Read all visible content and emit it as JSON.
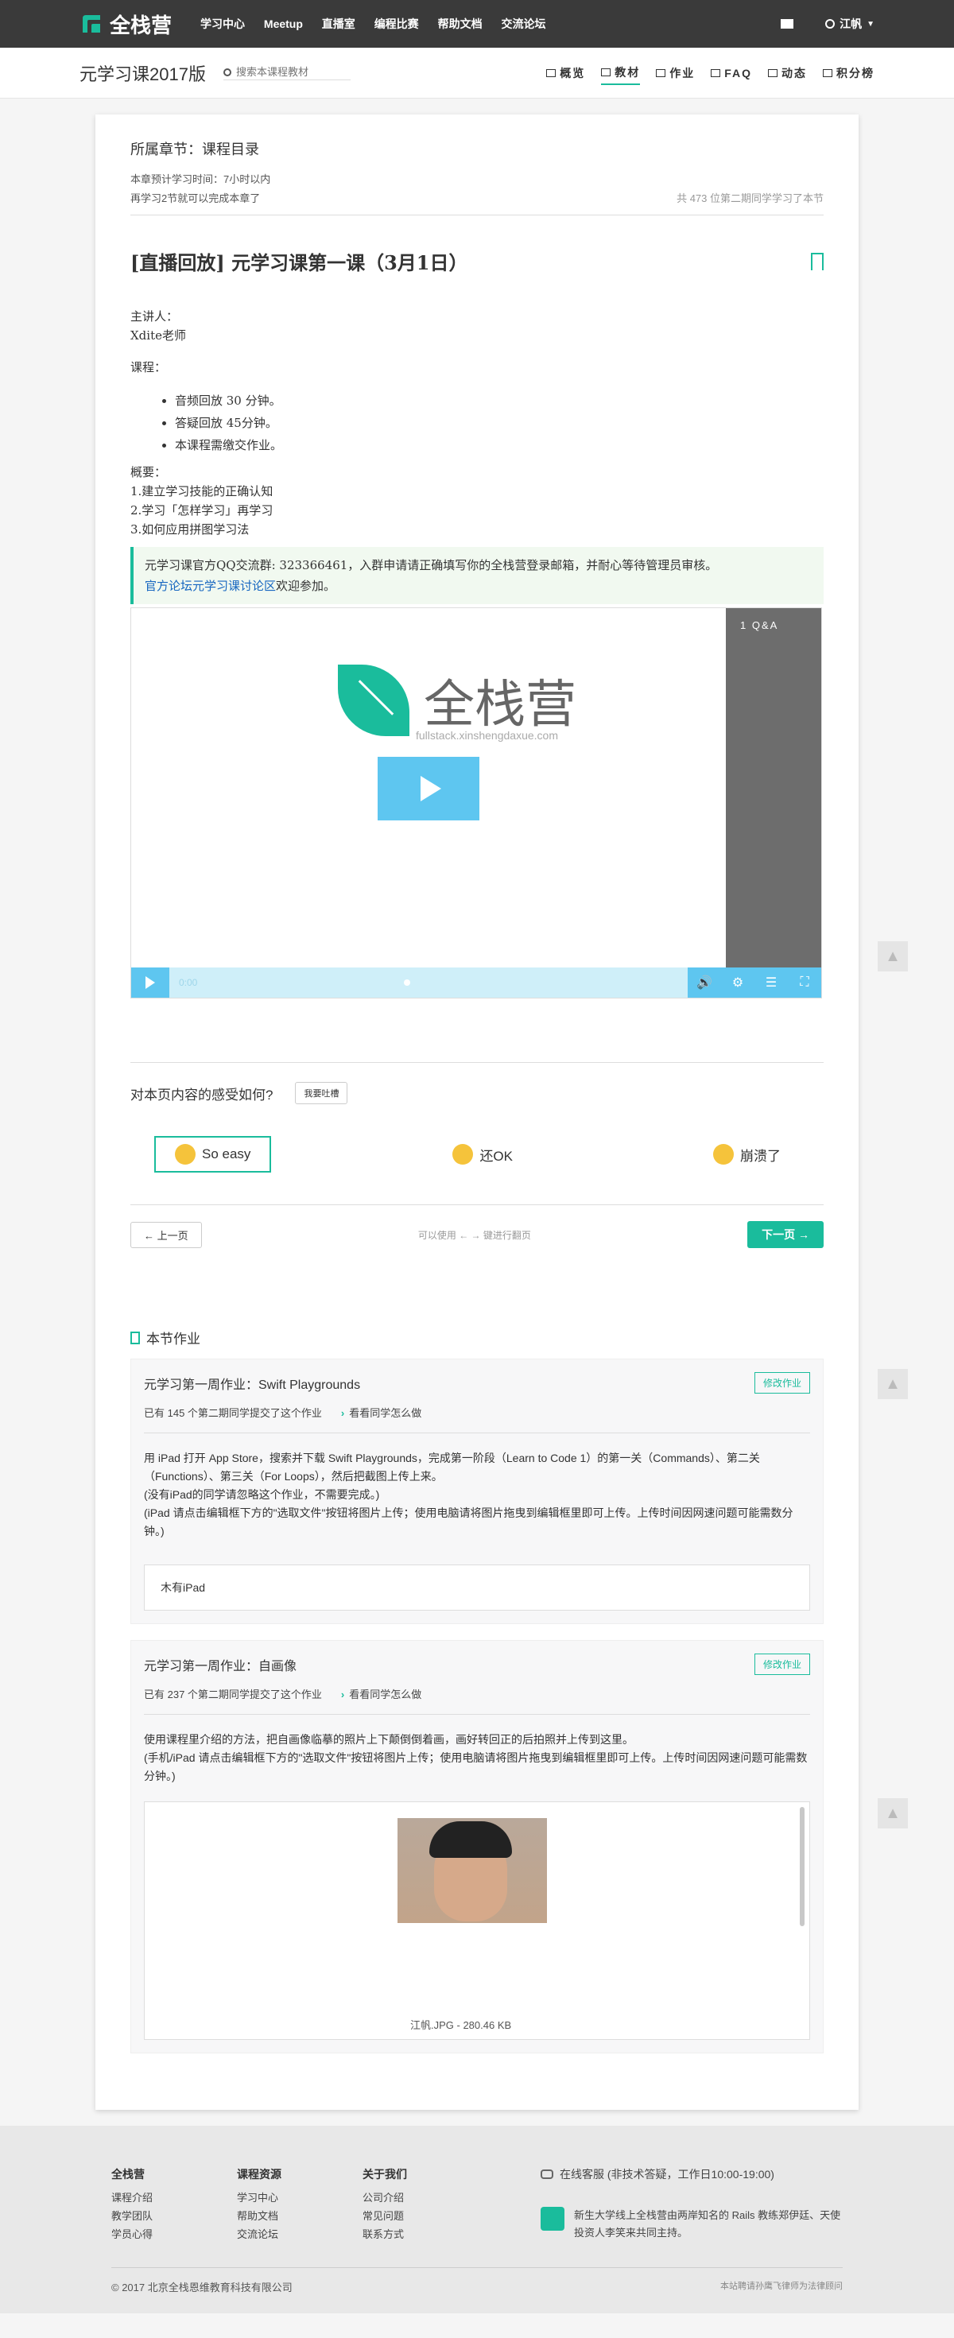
{
  "header": {
    "brand": "全栈营",
    "nav": [
      "学习中心",
      "Meetup",
      "直播室",
      "编程比赛",
      "帮助文档",
      "交流论坛"
    ],
    "user": "江帆"
  },
  "subnav": {
    "course_title": "元学习课2017版",
    "search_placeholder": "搜索本课程教材",
    "tabs": [
      "概览",
      "教材",
      "作业",
      "FAQ",
      "动态",
      "积分榜"
    ],
    "active_tab": "教材"
  },
  "chapter": {
    "label": "所属章节：课程目录",
    "time": "本章预计学习时间：7小时以内",
    "progress": "再学习2节就可以完成本章了",
    "learners": "共 473 位第二期同学学习了本节"
  },
  "lesson": {
    "title": "[直播回放] 元学习课第一课（3月1日）",
    "lecturer_label": "主讲人：",
    "lecturer": "Xdite老师",
    "course_label": "课程：",
    "items": [
      "音频回放 30 分钟。",
      "答疑回放 45分钟。",
      "本课程需缴交作业。"
    ],
    "summary_label": "概要：",
    "summary": [
      "1.建立学习技能的正确认知",
      "2.学习「怎样学习」再学习",
      "3.如何应用拼图学习法"
    ],
    "notice_text": "元学习课官方QQ交流群: 323366461，入群申请请正确填写你的全栈营登录邮箱，并耐心等待管理员审核。",
    "notice_link": "官方论坛元学习课讨论区",
    "notice_tail": "欢迎参加。"
  },
  "player": {
    "qa_label": "1 Q&A",
    "logo_text": "全栈营",
    "logo_sub": "fullstack.xinshengdaxue.com",
    "time": "0:00"
  },
  "feedback": {
    "question": "对本页内容的感受如何?",
    "complain_button": "我要吐槽",
    "choices": [
      "So easy",
      "还OK",
      "崩溃了"
    ]
  },
  "pager": {
    "prev": "上一页",
    "hint": "可以使用 ← → 键进行翻页",
    "next": "下一页"
  },
  "homework": {
    "section_title": "本节作业",
    "cards": [
      {
        "name": "元学习第一周作业：Swift Playgrounds",
        "edit": "修改作业",
        "submitted": "已有 145 个第二期同学提交了这个作业",
        "see": "看看同学怎么做",
        "desc": "用 iPad 打开 App Store，搜索并下载 Swift Playgrounds，完成第一阶段（Learn to Code 1）的第一关（Commands）、第二关（Functions）、第三关（For Loops），然后把截图上传上来。\n(没有iPad的同学请忽略这个作业，不需要完成。)\n(iPad 请点击编辑框下方的\"选取文件\"按钮将图片上传；使用电脑请将图片拖曳到编辑框里即可上传。上传时间因网速问题可能需数分钟。)",
        "answer": "木有iPad"
      },
      {
        "name": "元学习第一周作业：自画像",
        "edit": "修改作业",
        "submitted": "已有 237 个第二期同学提交了这个作业",
        "see": "看看同学怎么做",
        "desc": "使用课程里介绍的方法，把自画像临摹的照片上下颠倒倒着画，画好转回正的后拍照并上传到这里。\n(手机/iPad 请点击编辑框下方的\"选取文件\"按钮将图片上传；使用电脑请将图片拖曳到编辑框里即可上传。上传时间因网速问题可能需数分钟。)",
        "image_caption": "江帆.JPG - 280.46 KB"
      }
    ]
  },
  "footer": {
    "cols": [
      {
        "title": "全栈营",
        "links": [
          "课程介绍",
          "教学团队",
          "学员心得"
        ]
      },
      {
        "title": "课程资源",
        "links": [
          "学习中心",
          "帮助文档",
          "交流论坛"
        ]
      },
      {
        "title": "关于我们",
        "links": [
          "公司介绍",
          "常见问题",
          "联系方式"
        ]
      }
    ],
    "service": "在线客服 (非技术答疑，工作日10:00-19:00)",
    "intro": "新生大学线上全栈营由两岸知名的 Rails 教练郑伊廷、天使投资人李笑来共同主持。",
    "copyright": "© 2017 北京全栈恩维教育科技有限公司",
    "legal": "本站聘请孙鹰飞律师为法律顾问"
  }
}
